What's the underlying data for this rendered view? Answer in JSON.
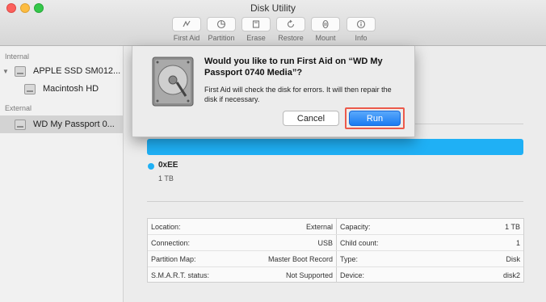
{
  "window": {
    "title": "Disk Utility"
  },
  "toolbar": {
    "items": [
      {
        "label": "First Aid",
        "icon": "first-aid-icon"
      },
      {
        "label": "Partition",
        "icon": "partition-icon"
      },
      {
        "label": "Erase",
        "icon": "erase-icon"
      },
      {
        "label": "Restore",
        "icon": "restore-icon"
      },
      {
        "label": "Mount",
        "icon": "mount-icon"
      },
      {
        "label": "Info",
        "icon": "info-icon"
      }
    ]
  },
  "sidebar": {
    "internal_header": "Internal",
    "external_header": "External",
    "items": [
      {
        "label": "APPLE SSD SM012...",
        "icon": "internal-disk-icon"
      },
      {
        "label": "Macintosh HD",
        "icon": "volume-icon"
      },
      {
        "label": "WD My Passport 0...",
        "icon": "external-disk-icon",
        "selected": true
      }
    ]
  },
  "dialog": {
    "title": "Would you like to run First Aid on “WD My Passport 0740 Media”?",
    "message": "First Aid will check the disk for errors. It will then repair the disk if necessary.",
    "cancel_label": "Cancel",
    "run_label": "Run"
  },
  "partition": {
    "name": "0xEE",
    "size": "1 TB",
    "color": "#1fb0f5"
  },
  "info_table": {
    "left": [
      {
        "key": "Location:",
        "value": "External"
      },
      {
        "key": "Connection:",
        "value": "USB"
      },
      {
        "key": "Partition Map:",
        "value": "Master Boot Record"
      },
      {
        "key": "S.M.A.R.T. status:",
        "value": "Not Supported"
      }
    ],
    "right": [
      {
        "key": "Capacity:",
        "value": "1 TB"
      },
      {
        "key": "Child count:",
        "value": "1"
      },
      {
        "key": "Type:",
        "value": "Disk"
      },
      {
        "key": "Device:",
        "value": "disk2"
      }
    ]
  },
  "colors": {
    "accent": "#1a7bf2",
    "highlight": "#ec5a4b"
  }
}
